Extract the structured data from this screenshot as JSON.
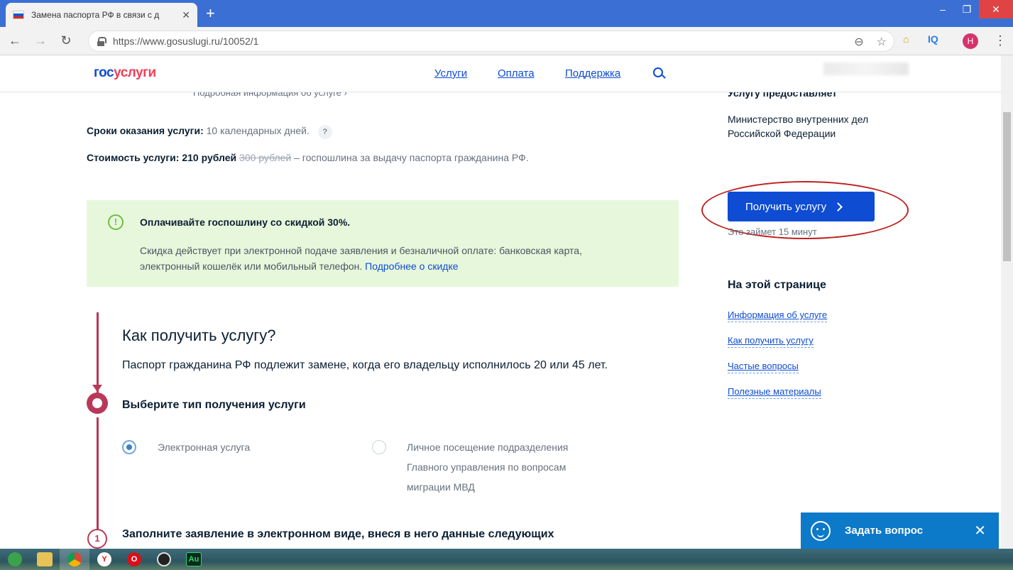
{
  "browser": {
    "tab_title": "Замена паспорта РФ в связи с д",
    "tab_close": "✕",
    "new_tab": "+",
    "url": "https://www.gosuslugi.ru/10052/1",
    "back": "←",
    "forward": "→",
    "reload": "↻",
    "zoom_icon": "⊖",
    "star_icon": "☆",
    "ext_iq": "IQ",
    "avatar_letter": "Н",
    "menu": "⋮",
    "win_min": "‒",
    "win_max": "❐",
    "win_close": "✕"
  },
  "header": {
    "logo_a": "гос",
    "logo_b": "услуги",
    "nav": [
      "Услуги",
      "Оплата",
      "Поддержка"
    ]
  },
  "details": {
    "more_info": "Подробная информация об услуге ›",
    "term_label": "Сроки оказания услуги:",
    "term_value": "10 календарных дней.",
    "term_help": "?",
    "cost_label": "Стоимость услуги:",
    "cost_value": "210 рублей",
    "cost_old": "300 рублей",
    "cost_note": "– госпошлина за выдачу паспорта гражданина РФ."
  },
  "promo": {
    "icon": "!",
    "title": "Оплачивайте госпошлину со скидкой 30%.",
    "text": "Скидка действует при электронной подаче заявления и безналичной оплате: банковская карта, электронный кошелёк или мобильный телефон.",
    "link": "Подробнее о скидке"
  },
  "how": {
    "title": "Как получить услугу?",
    "lead": "Паспорт гражданина РФ подлежит замене, когда его владельцу исполнилось 20 или 45 лет.",
    "step1_title": "Выберите тип получения услуги",
    "option_online": "Электронная услуга",
    "option_visit_1": "Личное посещение подразделения",
    "option_visit_2": "Главного управления по вопросам",
    "option_visit_3": "миграции МВД",
    "step2_number": "1",
    "step2_title": "Заполните заявление в электронном виде, внеся в него данные следующих"
  },
  "aside": {
    "provider_title": "Услугу предоставляет",
    "provider": "Министерство внутренних дел Российской Федерации",
    "cta": "Получить услугу",
    "cta_note": "Это займет 15 минут",
    "toc_title": "На этой странице",
    "toc": [
      "Информация об услуге",
      "Как получить услугу",
      "Частые вопросы",
      "Полезные материалы"
    ]
  },
  "chat": {
    "label": "Задать вопрос",
    "close": "✕"
  },
  "taskbar": {
    "apps": [
      "Y",
      "O",
      "Au"
    ]
  },
  "colors": {
    "brand_blue": "#0d4cd3",
    "brand_red": "#ee3f58",
    "accent_crimson": "#b9385a",
    "promo_bg": "#e7f7dc",
    "highlight_ring": "#c02020"
  }
}
